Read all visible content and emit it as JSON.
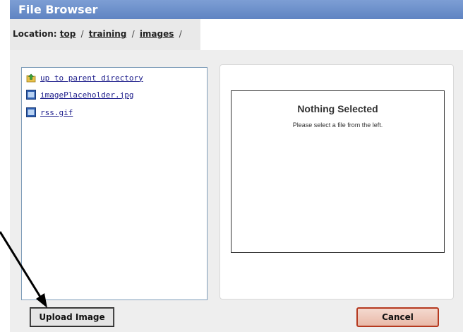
{
  "window": {
    "title": "File Browser"
  },
  "location": {
    "label": "Location:",
    "crumbs": [
      "top",
      "training",
      "images"
    ],
    "separator": "/"
  },
  "files": [
    {
      "name": "up to parent directory",
      "icon": "folder-up-icon"
    },
    {
      "name": "imagePlaceholder.jpg",
      "icon": "image-file-icon"
    },
    {
      "name": "rss.gif",
      "icon": "image-file-icon"
    }
  ],
  "preview": {
    "title": "Nothing Selected",
    "message": "Please select a file from the left."
  },
  "buttons": {
    "upload": "Upload Image",
    "cancel": "Cancel"
  },
  "colors": {
    "titlebar": "#6b8fc9",
    "cancel_border": "#b5391f"
  }
}
